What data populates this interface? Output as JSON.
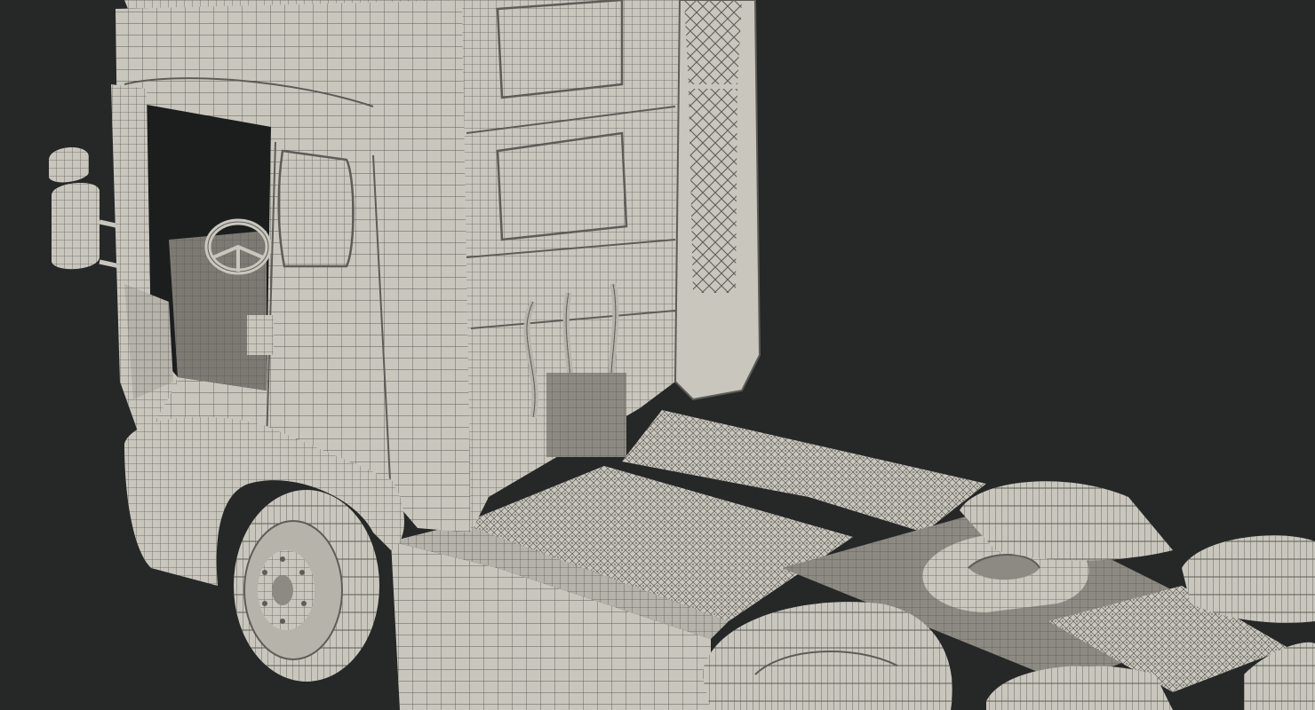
{
  "image": {
    "subject": "truck-tractor-wireframe-render",
    "colors": {
      "background": "#262727",
      "surface": "#c9c7bd",
      "surface_shadow": "#a9a79e",
      "surface_dark": "#8c8a82",
      "wire": "#5d5c57",
      "wire_light": "#77766f",
      "cab_interior": "#1c1d1d"
    }
  }
}
